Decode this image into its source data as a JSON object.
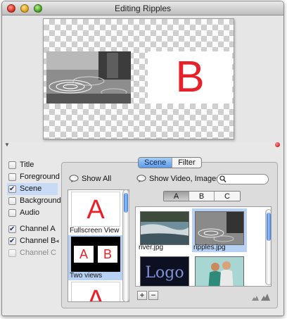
{
  "window": {
    "title": "Editing Ripples"
  },
  "preview": {
    "clip_a_letter": "",
    "clip_b_letter": "B"
  },
  "layers": [
    {
      "label": "Title",
      "checked": false,
      "selected": false,
      "disabled": false
    },
    {
      "label": "Foreground",
      "checked": false,
      "selected": false,
      "disabled": false
    },
    {
      "label": "Scene",
      "checked": true,
      "selected": true,
      "disabled": false
    },
    {
      "label": "Background",
      "checked": false,
      "selected": false,
      "disabled": false
    },
    {
      "label": "Audio",
      "checked": false,
      "selected": false,
      "disabled": false
    }
  ],
  "channels": [
    {
      "label": "Channel A",
      "checked": true,
      "disabled": false
    },
    {
      "label": "Channel B",
      "checked": true,
      "disabled": false
    },
    {
      "label": "Channel C",
      "checked": false,
      "disabled": true
    }
  ],
  "inspector": {
    "tabs": [
      "Scene",
      "Filter"
    ],
    "active_tab": "Scene",
    "show_all_label": "Show All",
    "show_video_label": "Show Video, Images",
    "search_placeholder": "",
    "channel_tabs": [
      "A",
      "B",
      "C"
    ],
    "active_channel": "A",
    "scenes": [
      {
        "label": "Fullscreen View",
        "thumb": "A"
      },
      {
        "label": "Two views",
        "thumb_left": "A",
        "thumb_right": "B"
      },
      {
        "label": "",
        "thumb": "A"
      }
    ],
    "media": [
      {
        "label": "river.jpg"
      },
      {
        "label": "ripples.jpg"
      },
      {
        "label": "",
        "thumb_text": "Logo"
      },
      {
        "label": ""
      }
    ],
    "add_label": "+",
    "remove_label": "−"
  },
  "colors": {
    "accent": "#5e9be6",
    "brand_red": "#e8202a",
    "selection": "#b7d1f4"
  },
  "icons": [
    "disclosure-triangle-icon",
    "record-dot-icon",
    "speech-bubble-icon",
    "magnifier-icon",
    "zoom-out-mountain-icon",
    "zoom-in-mountain-icon"
  ]
}
